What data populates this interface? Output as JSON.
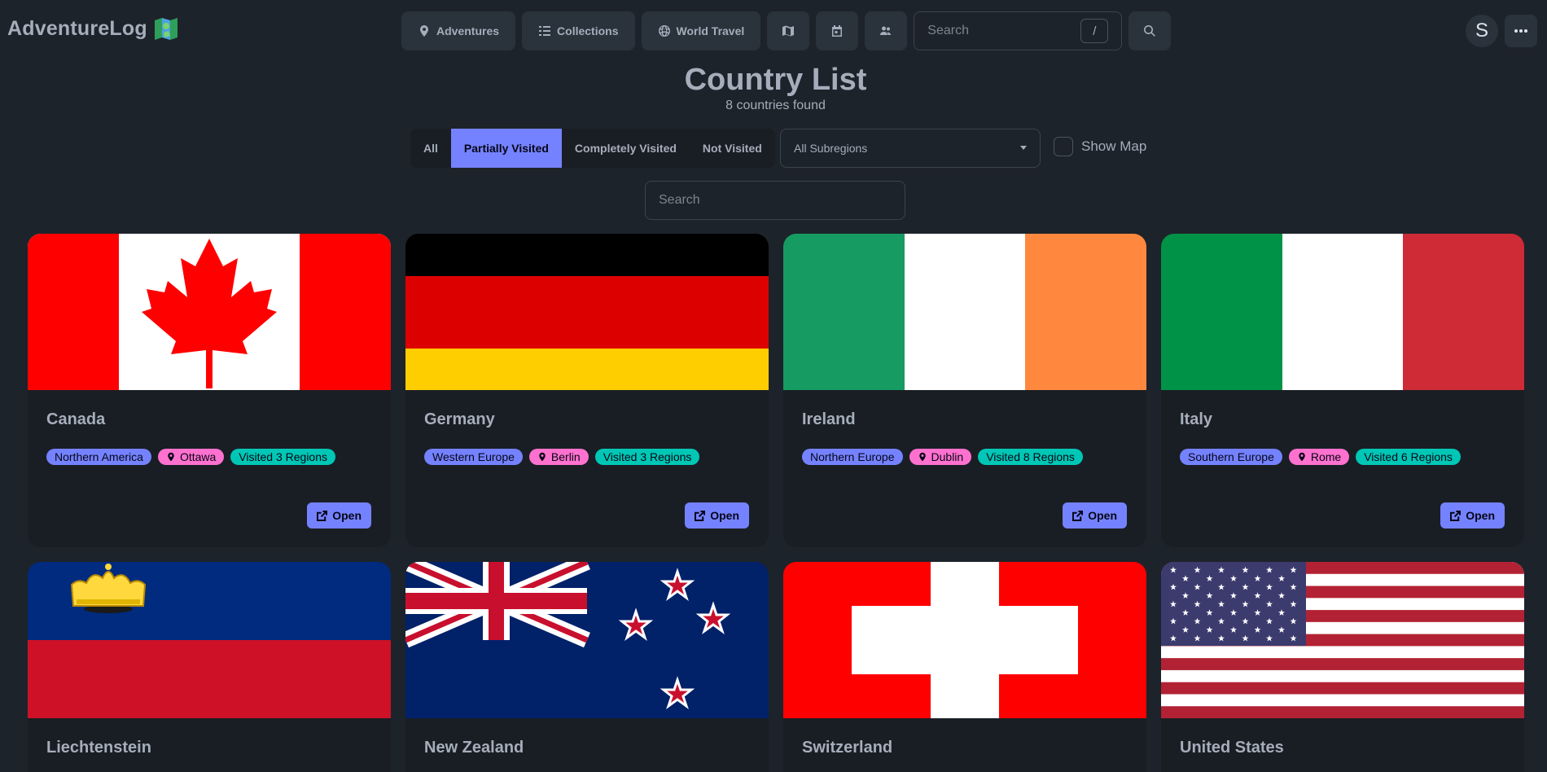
{
  "navbar": {
    "brand": "AdventureLog",
    "buttons": [
      {
        "label": "Adventures",
        "icon": "map-pin-icon"
      },
      {
        "label": "Collections",
        "icon": "list-icon"
      },
      {
        "label": "World Travel",
        "icon": "globe-icon"
      }
    ],
    "search_placeholder": "Search",
    "search_shortcut": "/",
    "avatar_initial": "S"
  },
  "page": {
    "title": "Country List",
    "subtitle": "8 countries found"
  },
  "filters": {
    "options": [
      "All",
      "Partially Visited",
      "Completely Visited",
      "Not Visited"
    ],
    "active": "Partially Visited",
    "subregion_selected": "All Subregions",
    "show_map_label": "Show Map",
    "search_placeholder": "Search"
  },
  "colors": {
    "accent": "#7582ff",
    "capital_badge": "#ff71cf",
    "visited_badge": "#00c7b5",
    "background": "#1d232a",
    "card": "#191e24"
  },
  "countries": [
    {
      "name": "Canada",
      "subregion": "Northern America",
      "capital": "Ottawa",
      "visited": "Visited 3 Regions",
      "open_label": "Open",
      "flag": "canada-flag"
    },
    {
      "name": "Germany",
      "subregion": "Western Europe",
      "capital": "Berlin",
      "visited": "Visited 3 Regions",
      "open_label": "Open",
      "flag": "germany-flag"
    },
    {
      "name": "Ireland",
      "subregion": "Northern Europe",
      "capital": "Dublin",
      "visited": "Visited 8 Regions",
      "open_label": "Open",
      "flag": "ireland-flag"
    },
    {
      "name": "Italy",
      "subregion": "Southern Europe",
      "capital": "Rome",
      "visited": "Visited 6 Regions",
      "open_label": "Open",
      "flag": "italy-flag"
    },
    {
      "name": "Liechtenstein",
      "flag": "liechtenstein-flag"
    },
    {
      "name": "New Zealand",
      "flag": "new-zealand-flag"
    },
    {
      "name": "Switzerland",
      "flag": "switzerland-flag"
    },
    {
      "name": "United States",
      "flag": "united-states-flag"
    }
  ]
}
